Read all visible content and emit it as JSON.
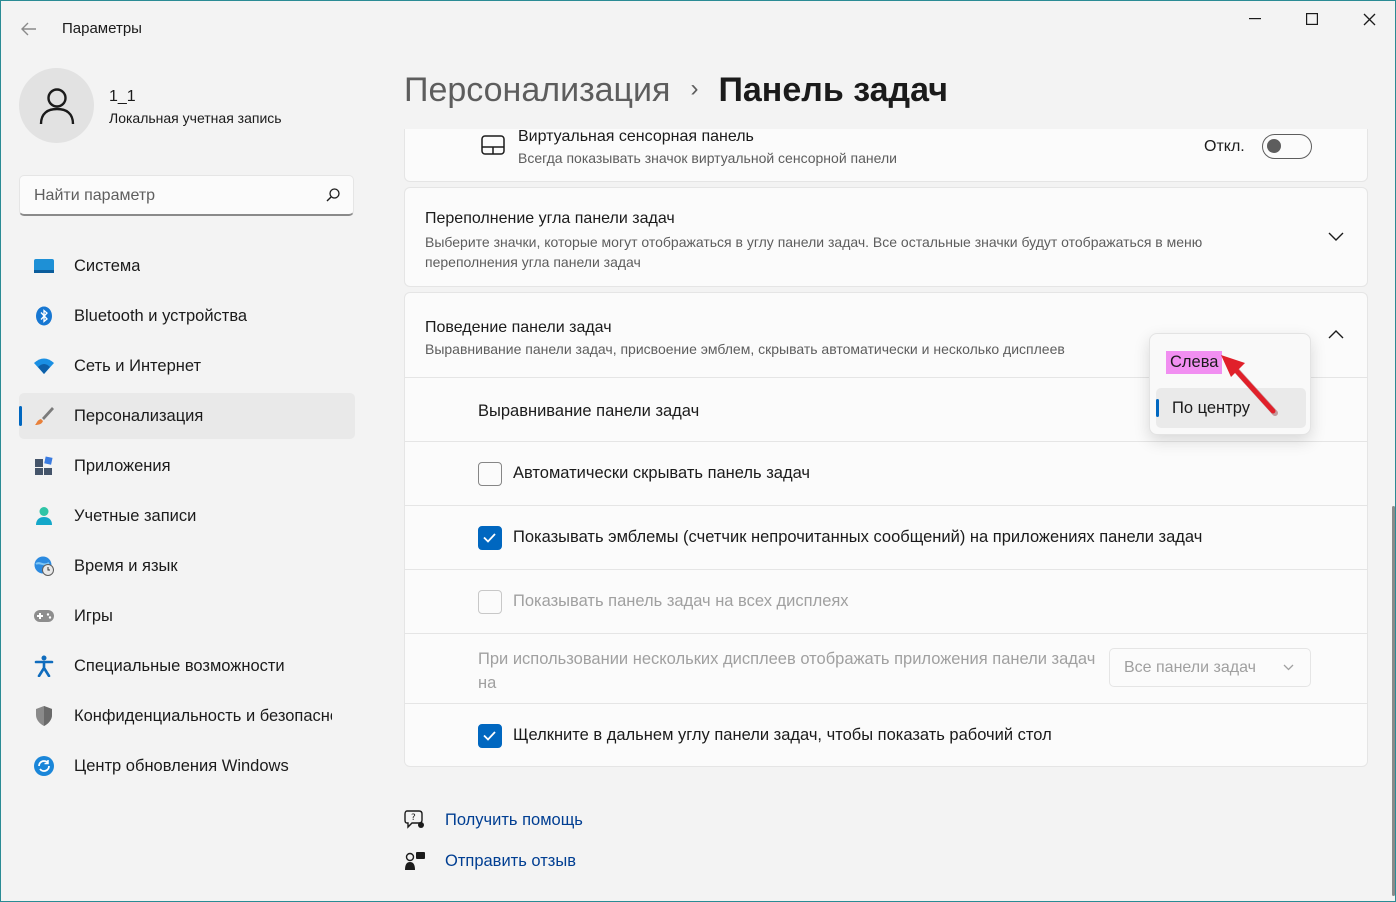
{
  "app": {
    "title": "Параметры"
  },
  "user": {
    "name": "1_1",
    "type": "Локальная учетная запись"
  },
  "search": {
    "placeholder": "Найти параметр"
  },
  "sidebar": {
    "items": [
      {
        "label": "Система",
        "icon": "system-icon"
      },
      {
        "label": "Bluetooth и устройства",
        "icon": "bluetooth-icon"
      },
      {
        "label": "Сеть и Интернет",
        "icon": "wifi-icon"
      },
      {
        "label": "Персонализация",
        "icon": "brush-icon",
        "selected": true
      },
      {
        "label": "Приложения",
        "icon": "apps-icon"
      },
      {
        "label": "Учетные записи",
        "icon": "person-icon"
      },
      {
        "label": "Время и язык",
        "icon": "globe-clock-icon"
      },
      {
        "label": "Игры",
        "icon": "gamepad-icon"
      },
      {
        "label": "Специальные возможности",
        "icon": "accessibility-icon"
      },
      {
        "label": "Конфиденциальность и безопасность",
        "icon": "shield-icon"
      },
      {
        "label": "Центр обновления Windows",
        "icon": "update-icon"
      }
    ]
  },
  "breadcrumb": {
    "parent": "Персонализация",
    "separator": "›",
    "current": "Панель задач"
  },
  "touchpad": {
    "title": "Виртуальная сенсорная панель",
    "description": "Всегда показывать значок виртуальной сенсорной панели",
    "toggle_label": "Откл.",
    "toggle_on": false
  },
  "overflow": {
    "title": "Переполнение угла панели задач",
    "description": "Выберите значки, которые могут отображаться в углу панели задач. Все остальные значки будут отображаться в меню переполнения угла панели задач"
  },
  "behavior": {
    "title": "Поведение панели задач",
    "description": "Выравнивание панели задач, присвоение эмблем, скрывать автоматически и несколько дисплеев",
    "alignment_label": "Выравнивание панели задач",
    "alignment_options": [
      "Слева",
      "По центру"
    ],
    "alignment_selected": "По центру",
    "autohide_label": "Автоматически скрывать панель задач",
    "autohide_checked": false,
    "badges_label": "Показывать эмблемы (счетчик непрочитанных сообщений) на приложениях панели задач",
    "badges_checked": true,
    "all_displays_label": "Показывать панель задач на всех дисплеях",
    "all_displays_checked": false,
    "multi_display_label": "При использовании нескольких дисплеев отображать приложения панели задач на",
    "multi_display_value": "Все панели задач",
    "far_corner_label": "Щелкните в дальнем углу панели задач, чтобы показать рабочий стол",
    "far_corner_checked": true
  },
  "help": {
    "get_help": "Получить помощь",
    "feedback": "Отправить отзыв"
  },
  "colors": {
    "accent": "#0067c0",
    "highlight": "#f18ff1",
    "annotation_arrow": "#e0202a"
  }
}
